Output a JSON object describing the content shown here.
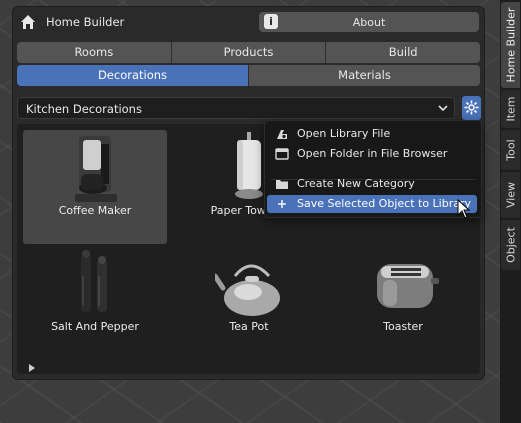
{
  "panel": {
    "title": "Home Builder",
    "about_label": "About",
    "about_icon": "info-icon"
  },
  "tabs": {
    "row1": [
      "Rooms",
      "Products",
      "Build"
    ],
    "row2": [
      "Decorations",
      "Materials"
    ],
    "active": "Decorations"
  },
  "library_select": {
    "value": "Kitchen Decorations"
  },
  "items": [
    {
      "label": "Coffee Maker",
      "selected": true
    },
    {
      "label": "Paper Towel H"
    },
    {
      "label": "Salt And Pepper"
    },
    {
      "label": "Tea Pot"
    },
    {
      "label": "Toaster"
    }
  ],
  "context_menu": {
    "items": [
      {
        "label": "Open Library File",
        "icon": "blender-file-icon"
      },
      {
        "label": "Open Folder in File Browser",
        "icon": "file-browser-icon"
      },
      {
        "label": "Create New Category",
        "icon": "folder-icon"
      },
      {
        "label": "Save Selected Object to Library",
        "icon": "plus-icon",
        "highlighted": true
      }
    ]
  },
  "sidebar_tabs": [
    "Home Builder",
    "Item",
    "Tool",
    "View",
    "Object"
  ],
  "colors": {
    "accent": "#4a72b8",
    "panel_bg": "#2a2a2a",
    "button_bg": "#545454"
  }
}
